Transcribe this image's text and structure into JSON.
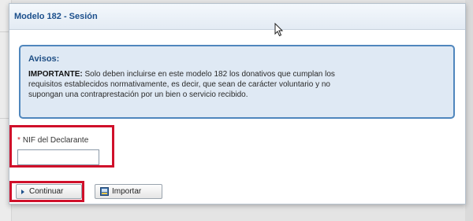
{
  "dialog": {
    "title": "Modelo 182 - Sesión"
  },
  "notice": {
    "title": "Avisos:",
    "strong": "IMPORTANTE:",
    "line1": " Solo deben incluirse en este modelo 182 los donativos que cumplan los",
    "line2": "requisitos establecidos normativamente, es decir, que sean de carácter voluntario y no",
    "line3": "supongan una contraprestación por un bien o servicio recibido."
  },
  "form": {
    "required_mark": "*",
    "nif_label": "NIF del Declarante",
    "nif_value": ""
  },
  "buttons": {
    "continuar": "Continuar",
    "importar": "Importar"
  },
  "colors": {
    "title_blue": "#1b4f8c",
    "notice_bg": "#dfe9f4",
    "notice_border": "#4f86bd",
    "highlight_red": "#d0102a"
  },
  "icons": {
    "continuar": "triangle-right-icon",
    "importar": "import-icon",
    "cursor": "mouse-pointer-icon"
  }
}
